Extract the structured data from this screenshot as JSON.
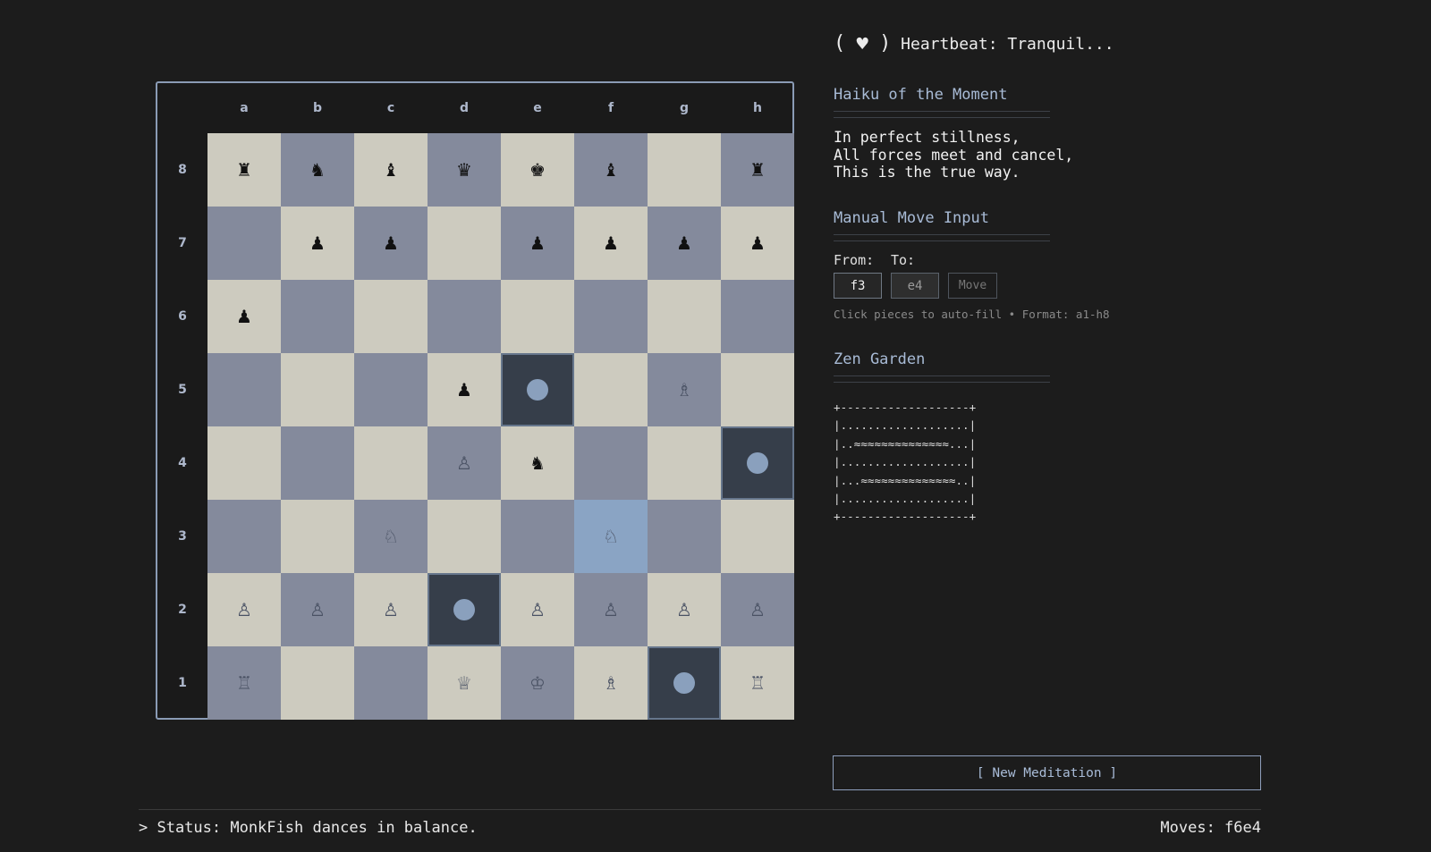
{
  "heartbeat": {
    "open": "(",
    "icon": "♥",
    "close": ")",
    "text": "Heartbeat: Tranquil..."
  },
  "board": {
    "files": [
      "a",
      "b",
      "c",
      "d",
      "e",
      "f",
      "g",
      "h"
    ],
    "ranks": [
      "8",
      "7",
      "6",
      "5",
      "4",
      "3",
      "2",
      "1"
    ],
    "colors": {
      "light": "#cdcbbf",
      "dark": "#848a9c",
      "selected": "#8aa4c4",
      "target": "#363e4a",
      "dot": "#8aa0bd"
    },
    "selected_square": "f3",
    "target_squares": [
      "e5",
      "h4",
      "d2",
      "g1"
    ],
    "pieces": {
      "a8": {
        "glyph": "♜",
        "color": "black",
        "name": "rook"
      },
      "b8": {
        "glyph": "♞",
        "color": "black",
        "name": "knight"
      },
      "c8": {
        "glyph": "♝",
        "color": "black",
        "name": "bishop"
      },
      "d8": {
        "glyph": "♛",
        "color": "black",
        "name": "queen"
      },
      "e8": {
        "glyph": "♚",
        "color": "black",
        "name": "king"
      },
      "f8": {
        "glyph": "♝",
        "color": "black",
        "name": "bishop"
      },
      "h8": {
        "glyph": "♜",
        "color": "black",
        "name": "rook"
      },
      "b7": {
        "glyph": "♟",
        "color": "black",
        "name": "pawn"
      },
      "c7": {
        "glyph": "♟",
        "color": "black",
        "name": "pawn"
      },
      "e7": {
        "glyph": "♟",
        "color": "black",
        "name": "pawn"
      },
      "f7": {
        "glyph": "♟",
        "color": "black",
        "name": "pawn"
      },
      "g7": {
        "glyph": "♟",
        "color": "black",
        "name": "pawn"
      },
      "h7": {
        "glyph": "♟",
        "color": "black",
        "name": "pawn"
      },
      "a6": {
        "glyph": "♟",
        "color": "black",
        "name": "pawn"
      },
      "d5": {
        "glyph": "♟",
        "color": "black",
        "name": "pawn"
      },
      "g5": {
        "glyph": "♗",
        "color": "white",
        "name": "bishop"
      },
      "d4": {
        "glyph": "♙",
        "color": "white",
        "name": "pawn"
      },
      "e4": {
        "glyph": "♞",
        "color": "black",
        "name": "knight"
      },
      "c3": {
        "glyph": "♘",
        "color": "white",
        "name": "knight"
      },
      "f3": {
        "glyph": "♘",
        "color": "white",
        "name": "knight"
      },
      "a2": {
        "glyph": "♙",
        "color": "white",
        "name": "pawn"
      },
      "b2": {
        "glyph": "♙",
        "color": "white",
        "name": "pawn"
      },
      "c2": {
        "glyph": "♙",
        "color": "white",
        "name": "pawn"
      },
      "e2": {
        "glyph": "♙",
        "color": "white",
        "name": "pawn"
      },
      "f2": {
        "glyph": "♙",
        "color": "white",
        "name": "pawn"
      },
      "g2": {
        "glyph": "♙",
        "color": "white",
        "name": "pawn"
      },
      "h2": {
        "glyph": "♙",
        "color": "white",
        "name": "pawn"
      },
      "a1": {
        "glyph": "♖",
        "color": "white",
        "name": "rook"
      },
      "d1": {
        "glyph": "♕",
        "color": "white",
        "name": "queen"
      },
      "e1": {
        "glyph": "♔",
        "color": "white",
        "name": "king"
      },
      "f1": {
        "glyph": "♗",
        "color": "white",
        "name": "bishop"
      },
      "h1": {
        "glyph": "♖",
        "color": "white",
        "name": "rook"
      }
    }
  },
  "haiku": {
    "title": "Haiku of the Moment",
    "lines": [
      "In perfect stillness,",
      "All forces meet and cancel,",
      "This is the true way."
    ]
  },
  "manual_move": {
    "title": "Manual Move Input",
    "from_label": "From:",
    "to_label": "To:",
    "from_value": "f3",
    "to_value": "e4",
    "move_label": "Move",
    "hint": "Click pieces to auto-fill • Format: a1-h8"
  },
  "zen_garden": {
    "title": "Zen Garden",
    "lines": [
      "+-------------------+",
      "|...................|",
      "|..≈≈≈≈≈≈≈≈≈≈≈≈≈≈...|",
      "|...................|",
      "|...≈≈≈≈≈≈≈≈≈≈≈≈≈≈..|",
      "|...................|",
      "+-------------------+"
    ]
  },
  "new_meditation_label": "[ New Meditation ]",
  "status": "> Status: MonkFish dances in balance.",
  "moves": "Moves: f6e4"
}
